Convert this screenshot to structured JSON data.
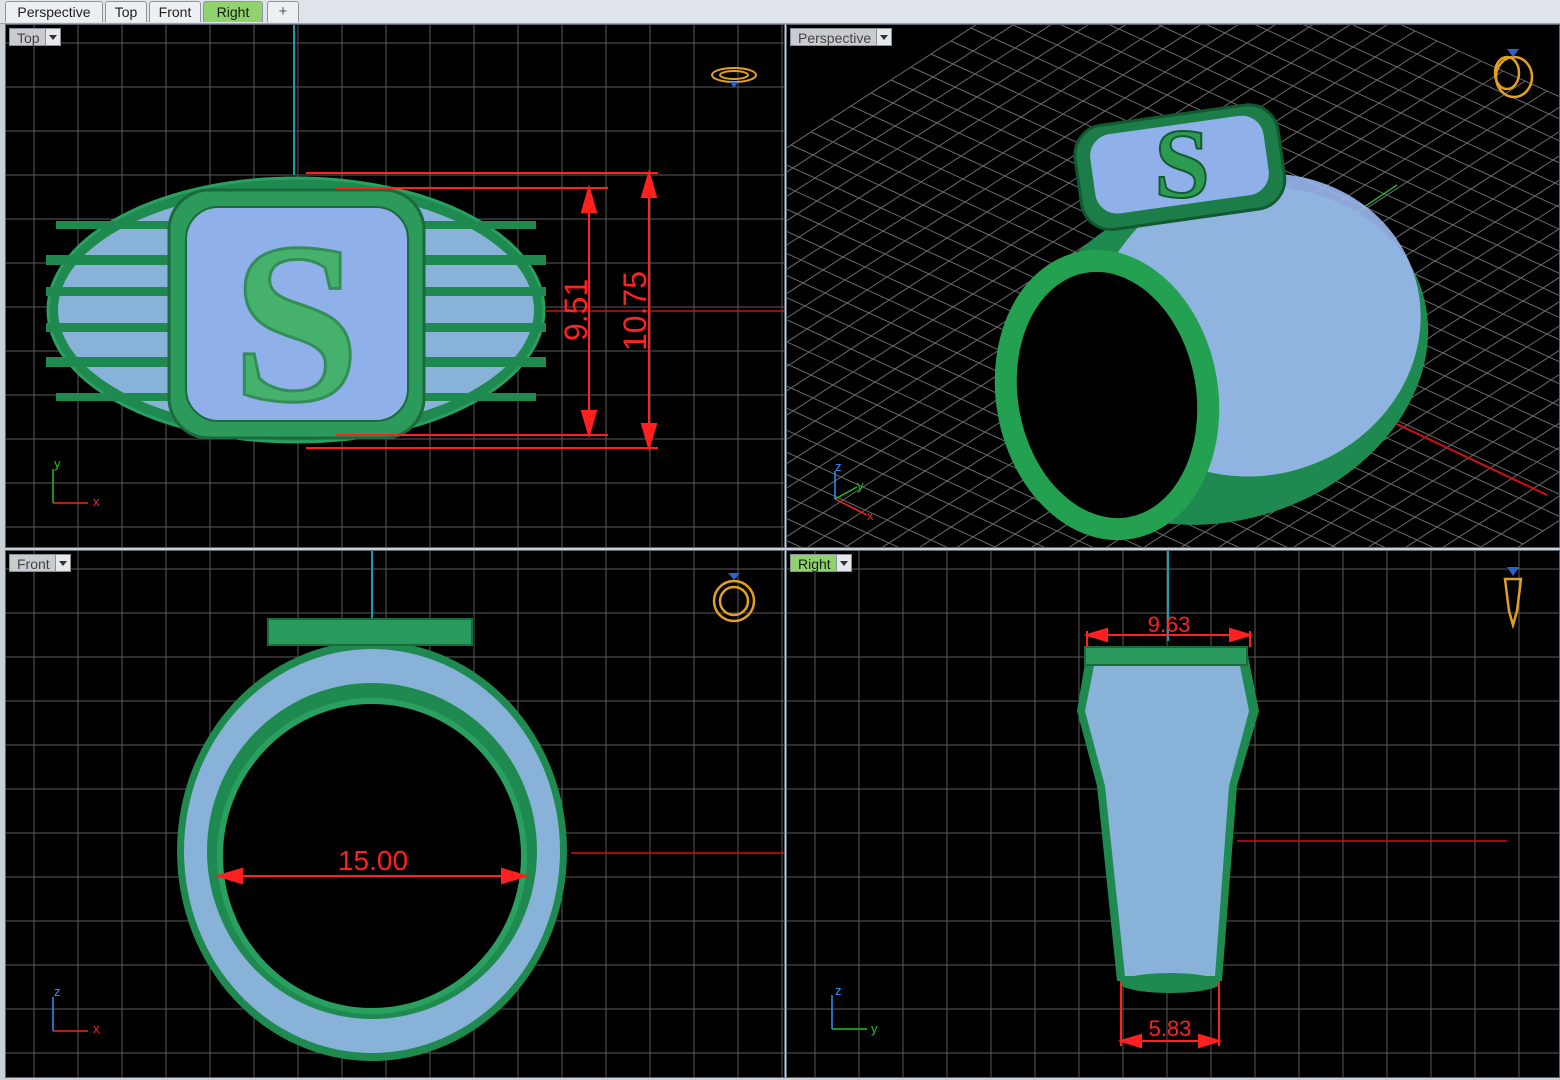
{
  "tabs": [
    {
      "label": "Perspective",
      "active": false
    },
    {
      "label": "Top",
      "active": false
    },
    {
      "label": "Front",
      "active": false
    },
    {
      "label": "Right",
      "active": true
    }
  ],
  "add_tab_icon": "plus-icon",
  "viewports": {
    "top": {
      "label": "Top",
      "dimensions": [
        "9.51",
        "10.75"
      ],
      "axes": [
        "y",
        "x"
      ]
    },
    "perspective": {
      "label": "Perspective",
      "axes": [
        "z",
        "y",
        "x"
      ]
    },
    "front": {
      "label": "Front",
      "dimensions": [
        "15.00"
      ],
      "axes": [
        "z",
        "x"
      ]
    },
    "right": {
      "label": "Right",
      "dimensions": [
        "9.63",
        "5.83"
      ],
      "axes": [
        "z",
        "y"
      ]
    }
  },
  "colors": {
    "metal": "#1f8a50",
    "gem": "#9bb8f0",
    "grid": "#6a6a6a",
    "dimension": "#ff2020",
    "gumball": "#e2a020",
    "axis_x": "#ff2020",
    "axis_y": "#20c020",
    "axis_z": "#3090ff"
  }
}
